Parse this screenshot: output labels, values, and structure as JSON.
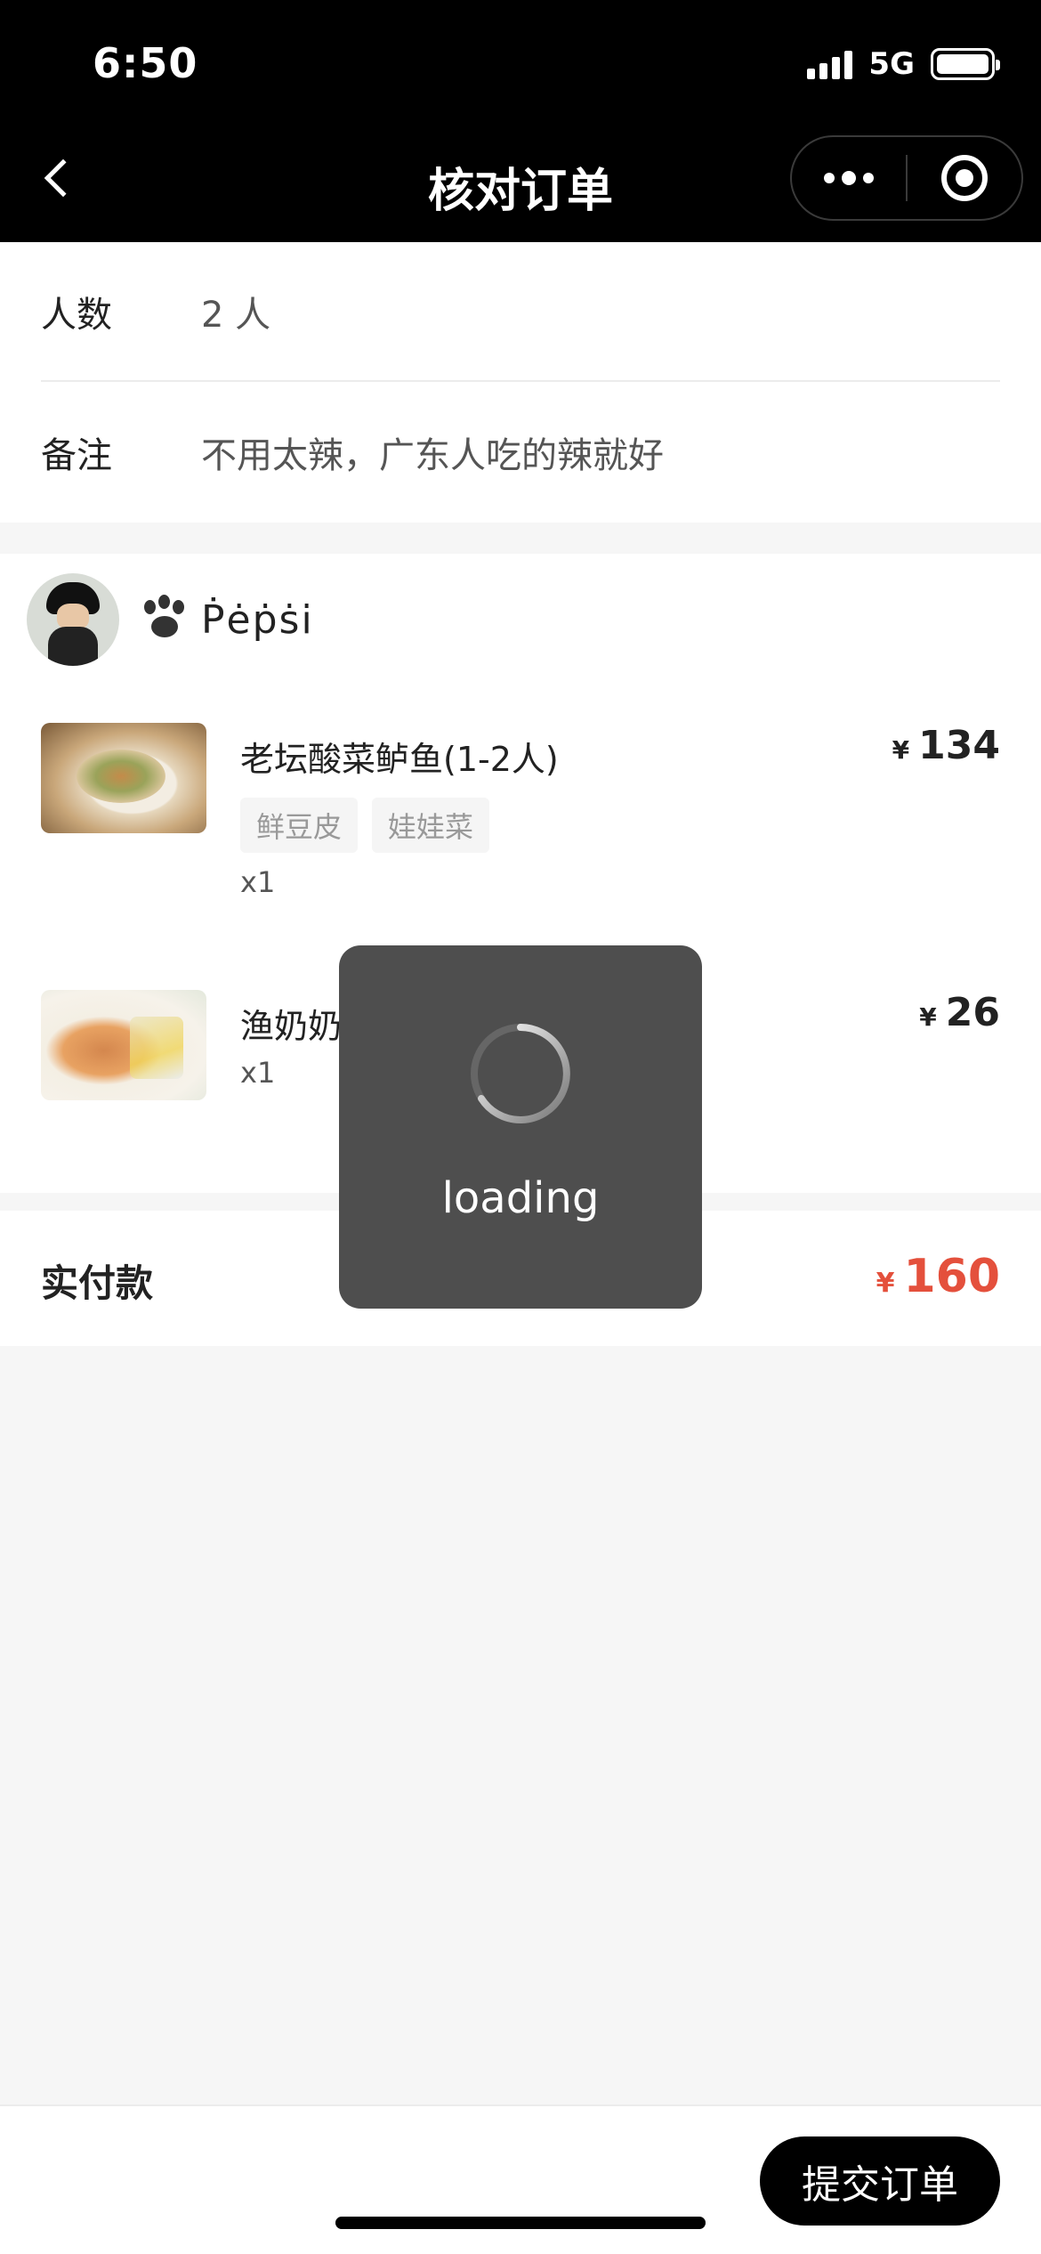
{
  "status_bar": {
    "time": "6:50",
    "network": "5G",
    "icons": [
      "signal-icon",
      "battery-icon"
    ]
  },
  "nav": {
    "back_icon": "chevron-left-icon",
    "title": "核对订单",
    "menu_icon": "more-dots-icon",
    "close_icon": "target-icon"
  },
  "info": {
    "people": {
      "label": "人数",
      "value": "2 人"
    },
    "note": {
      "label": "备注",
      "value": "不用太辣，广东人吃的辣就好"
    }
  },
  "order": {
    "user_name": "Ṗėṗṡi",
    "user_icon": "paw-icon",
    "items": [
      {
        "name": "老坛酸菜鲈鱼(1-2人)",
        "tags": [
          "鲜豆皮",
          "娃娃菜"
        ],
        "qty": "x1",
        "currency": "¥",
        "price": "134"
      },
      {
        "name": "渔奶奶",
        "tags": [],
        "qty": "x1",
        "currency": "¥",
        "price": "26"
      }
    ]
  },
  "total": {
    "label": "实付款",
    "currency": "¥",
    "amount": "160"
  },
  "bottom": {
    "submit_label": "提交订单"
  },
  "loading": {
    "text": "loading"
  },
  "colors": {
    "accent_price": "#e4503c",
    "nav_bg": "#000000",
    "page_bg": "#f6f6f6"
  }
}
